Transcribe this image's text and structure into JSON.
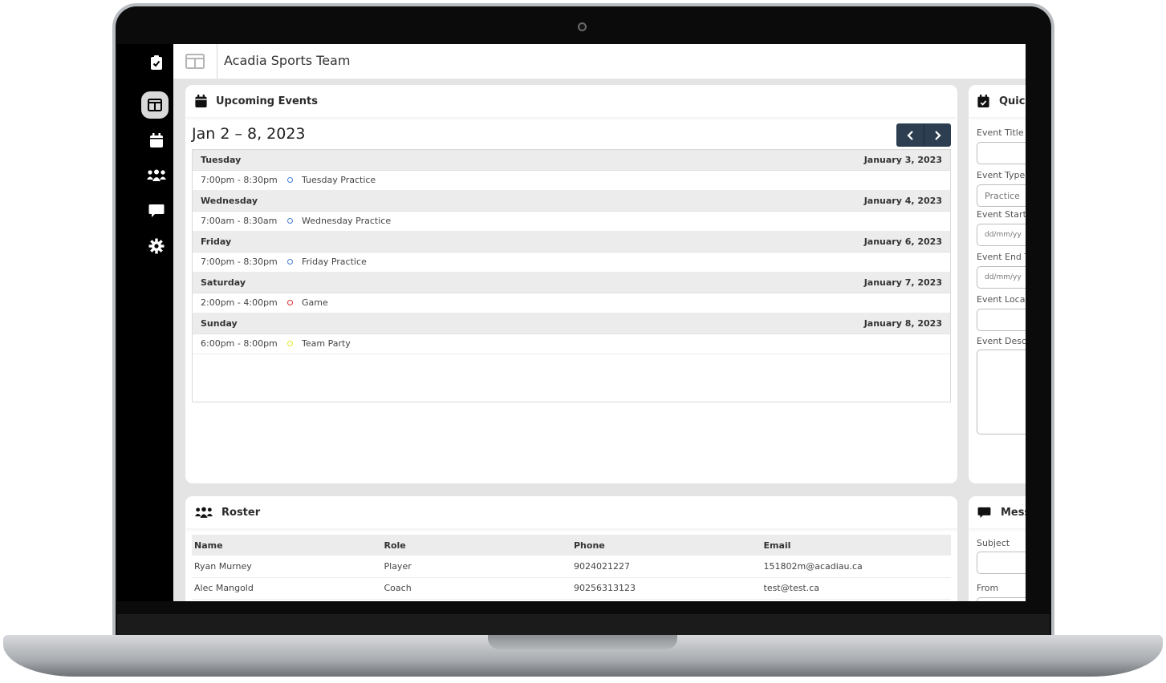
{
  "app": {
    "title": "Acadia Sports Team"
  },
  "sidebar": {
    "items": [
      {
        "icon": "clipboard-check-icon",
        "active": false
      },
      {
        "icon": "dashboard-icon",
        "active": true
      },
      {
        "icon": "calendar-icon",
        "active": false
      },
      {
        "icon": "team-icon",
        "active": false
      },
      {
        "icon": "chat-icon",
        "active": false
      },
      {
        "icon": "gear-icon",
        "active": false
      }
    ]
  },
  "events": {
    "heading": "Upcoming Events",
    "range": "Jan 2 – 8, 2023",
    "days": [
      {
        "day": "Tuesday",
        "date": "January 3, 2023",
        "time": "7:00pm - 8:30pm",
        "title": "Tuesday Practice",
        "color": "#4a7fd4"
      },
      {
        "day": "Wednesday",
        "date": "January 4, 2023",
        "time": "7:00am - 8:30am",
        "title": "Wednesday Practice",
        "color": "#4a7fd4"
      },
      {
        "day": "Friday",
        "date": "January 6, 2023",
        "time": "7:00pm - 8:30pm",
        "title": "Friday Practice",
        "color": "#4a7fd4"
      },
      {
        "day": "Saturday",
        "date": "January 7, 2023",
        "time": "2:00pm - 4:00pm",
        "title": "Game",
        "color": "#e03131"
      },
      {
        "day": "Sunday",
        "date": "January 8, 2023",
        "time": "6:00pm - 8:00pm",
        "title": "Team Party",
        "color": "#e6e62e"
      }
    ]
  },
  "quick_add": {
    "heading": "Quicl",
    "labels": {
      "title": "Event Title",
      "type": "Event Type",
      "start": "Event Start",
      "end": "Event End T",
      "location": "Event Loca",
      "description": "Event Desc"
    },
    "type_value": "Practice",
    "date_placeholder": "dd/mm/yy"
  },
  "roster": {
    "heading": "Roster",
    "columns": [
      "Name",
      "Role",
      "Phone",
      "Email"
    ],
    "rows": [
      [
        "Ryan Murney",
        "Player",
        "9024021227",
        "151802m@acadiau.ca"
      ],
      [
        "Alec Mangold",
        "Coach",
        "90256313123",
        "test@test.ca"
      ]
    ]
  },
  "messages": {
    "heading": "Mess",
    "subject_label": "Subject",
    "from_label": "From"
  },
  "colors": {
    "nav_button": "#2c3e50",
    "sidebar": "#000000"
  }
}
